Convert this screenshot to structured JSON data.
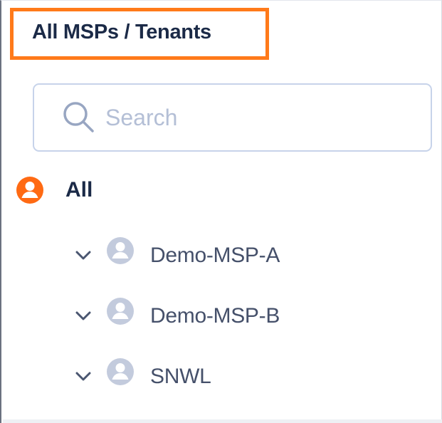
{
  "header": {
    "title": "All MSPs / Tenants"
  },
  "search": {
    "placeholder": "Search",
    "value": ""
  },
  "tree": {
    "root": {
      "label": "All",
      "icon": "user-circle-icon",
      "color": "#ff6a13"
    },
    "items": [
      {
        "label": "Demo-MSP-A",
        "icon": "user-circle-icon",
        "expander": "chevron-down-icon"
      },
      {
        "label": "Demo-MSP-B",
        "icon": "user-circle-icon",
        "expander": "chevron-down-icon"
      },
      {
        "label": "SNWL",
        "icon": "user-circle-icon",
        "expander": "chevron-down-icon"
      }
    ]
  },
  "colors": {
    "highlight": "#ff7a1a",
    "text_dark": "#1b2a47",
    "text_muted": "#45506a",
    "icon_muted": "#c3cbdd",
    "border": "#c7d3ea"
  }
}
